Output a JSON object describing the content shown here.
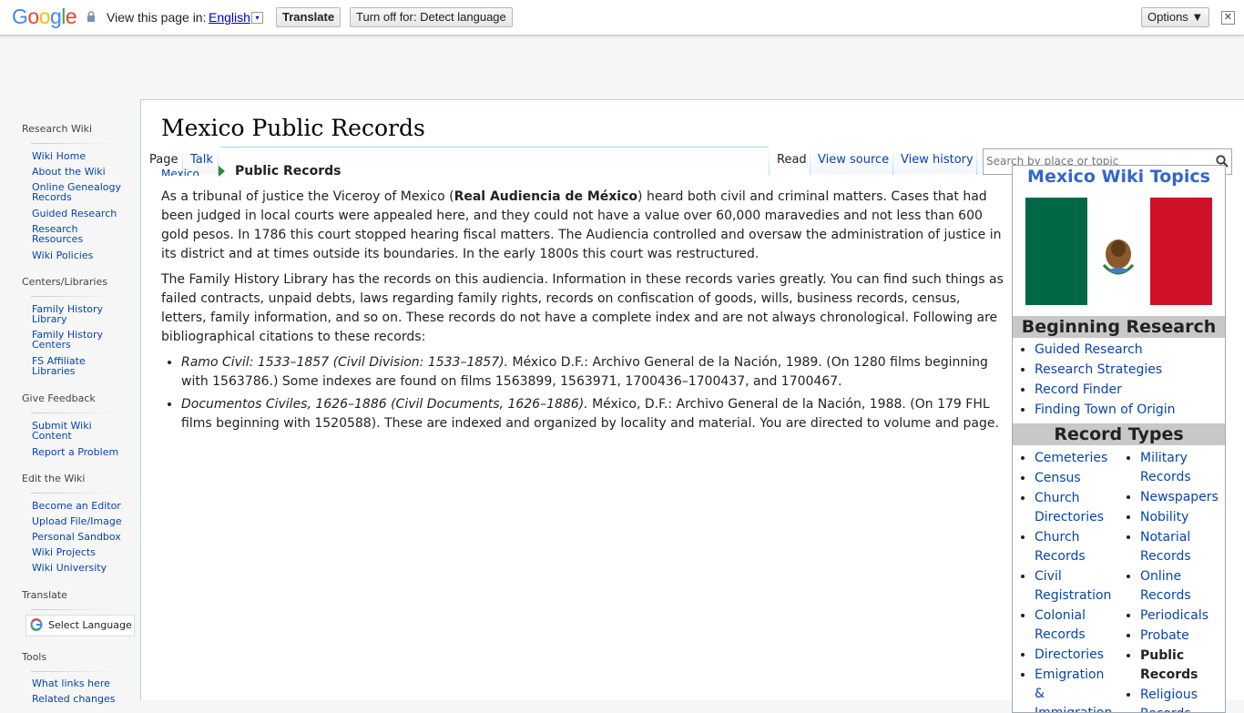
{
  "translate_bar": {
    "logo": "Google",
    "view_text": "View this page in:",
    "language": "English",
    "language_arrow": "▾",
    "translate_label": "Translate",
    "turn_off_label": "Turn off for: Detect language",
    "options_label": "Options ▼",
    "close_label": "✕"
  },
  "sidebar": {
    "sections": [
      {
        "title": "Research Wiki",
        "items": [
          "Wiki Home",
          "About the Wiki",
          "Online Genealogy Records",
          "Guided Research",
          "Research Resources",
          "Wiki Policies"
        ]
      },
      {
        "title": "Centers/Libraries",
        "items": [
          "Family History Library",
          "Family History Centers",
          "FS Affiliate Libraries"
        ]
      },
      {
        "title": "Give Feedback",
        "items": [
          "Submit Wiki Content",
          "Report a Problem"
        ]
      },
      {
        "title": "Edit the Wiki",
        "items": [
          "Become an Editor",
          "Upload File/Image",
          "Personal Sandbox",
          "Wiki Projects",
          "Wiki University"
        ]
      },
      {
        "title": "Translate",
        "items": []
      },
      {
        "title": "Tools",
        "items": [
          "What links here",
          "Related changes"
        ]
      }
    ],
    "select_language": "Select Language"
  },
  "page": {
    "title": "Mexico Public Records",
    "tabs": {
      "page": "Page",
      "talk": "Talk",
      "read": "Read",
      "view_source": "View source",
      "view_history": "View history"
    },
    "search_placeholder": "Search by place or topic",
    "breadcrumb_prev": "Mexico",
    "breadcrumb_current": "Public Records",
    "p1_a": "As a tribunal of justice the Viceroy of Mexico (",
    "p1_bold": "Real Audiencia de México",
    "p1_b": ") heard both civil and criminal matters. Cases that had been judged in local courts were appealed here, and they could not have a value over 60,000 maravedies and not less than 600 gold pesos. In 1786 this court stopped hearing fiscal matters. The Audiencia controlled and oversaw the administration of justice in its district and at times outside its boundaries. In the early 1800s this court was restructured.",
    "p2": "The Family History Library has the records on this audiencia. Information in these records varies greatly. You can find such things as failed contracts, unpaid debts, laws regarding family rights, records on confiscation of goods, wills, business records, census, letters, family information, and so on. These records do not have a complete index and are not always chronological. Following are bibliographical citations to these records:",
    "li1_em": "Ramo Civil: 1533–1857 (Civil Division: 1533–1857).",
    "li1_rest": " México D.F.: Archivo General de la Nación, 1989. (On 1280 films beginning with 1563786.) Some indexes are found on films 1563899, 1563971, 1700436–1700437, and 1700467.",
    "li2_em": "Documentos Civiles, 1626–1886 (Civil Documents, 1626–1886).",
    "li2_rest": " México, D.F.: Archivo General de la Nación, 1988. (On 179 FHL films beginning with 1520588). These are indexed and organized by locality and material. You are directed to volume and page."
  },
  "topics": {
    "title": "Mexico Wiki Topics",
    "beginning_title": "Beginning Research",
    "beginning_items": [
      "Guided Research",
      "Research Strategies",
      "Record Finder",
      "Finding Town of Origin"
    ],
    "record_types_title": "Record Types",
    "col1": [
      "Cemeteries",
      "Census",
      "Church Directories",
      "Church Records",
      "Civil Registration",
      "Colonial Records",
      "Directories",
      "Emigration & Immigration"
    ],
    "col2": [
      "Military Records",
      "Newspapers",
      "Nobility",
      "Notarial Records",
      "Online Records",
      "Periodicals",
      "Probate",
      "Public Records",
      "Religious Records"
    ]
  },
  "colors": {
    "link": "#0645ad",
    "flag_green": "#006847",
    "flag_red": "#ce1126",
    "topics_title": "#3366cc",
    "section_bg": "#c8c8c8"
  }
}
